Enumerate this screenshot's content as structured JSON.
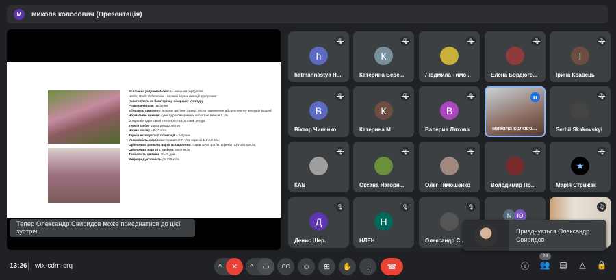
{
  "header": {
    "avatar_letter": "M",
    "title": "микола колосович (Презентація)"
  },
  "slide": {
    "lines": [
      {
        "b": "Echinacea purpurea Moench.- ",
        "t": "ехінацея пурпурова",
        "italic": true
      },
      {
        "b": "",
        "t": "Herba, Radix Echinaceae - трава і корені ехінації пурпурової",
        "italic": true
      },
      {
        "b": "Культивують як багаторічну лікарську культуру",
        "t": ""
      },
      {
        "b": "Розмножується: ",
        "t": "насінням"
      },
      {
        "b": "Збирають сировину: ",
        "t": "початок цвітіння (траву), після припинення або до початку вегетації (корені)"
      },
      {
        "b": "Нормативні вимоги: ",
        "t": "суми гідроксикоричних кислот не менше 2,1%"
      },
      {
        "b": "",
        "t": "В Україні є адаптовані технології та сортовий ресурс"
      },
      {
        "b": "Термін сівби",
        "t": " - друга декада квітня"
      },
      {
        "b": "Норма висіву",
        "t": " – 8-10 кг/га"
      },
      {
        "b": "Термін експлуатації плантації",
        "t": " – 3-4 роки"
      },
      {
        "b": "Урожайність сировини: ",
        "t": "трави 8,0-7, т/га; коренів 1,2-2,2 т/га;"
      },
      {
        "b": "Орієнтовна ринкова вартість сировини: ",
        "t": "трави 40-60 грн./кг; коренів -120-150 грн./кг;"
      },
      {
        "b": "Орієнтовна вартість насіння: ",
        "t": "500 грн./кг"
      },
      {
        "b": "Тривалість цвітіння ",
        "t": "30-40 днів."
      },
      {
        "b": "Медопродуктивність ",
        "t": "до 230 кг/га."
      }
    ]
  },
  "toast": "Тепер Олександр Свиридов може приєднатися до цієї зустрічі.",
  "participants": [
    {
      "name": "hatmannastya H...",
      "letter": "h",
      "color": "#5c6bc0"
    },
    {
      "name": "Катерина Бере...",
      "letter": "К",
      "color": "#78909c"
    },
    {
      "name": "Людмила Тимо...",
      "letter": "",
      "color": "#c9b03a"
    },
    {
      "name": "Елена Бордюго...",
      "letter": "",
      "color": "#8d3b3b"
    },
    {
      "name": "Ірина Кравець",
      "letter": "І",
      "color": "#6d4c41"
    },
    {
      "name": "Віктор Чипенко",
      "letter": "В",
      "color": "#5c6bc0"
    },
    {
      "name": "Катерина М",
      "letter": "К",
      "color": "#6d4c41"
    },
    {
      "name": "Валерия Ляхова",
      "letter": "В",
      "color": "#ab47bc"
    },
    {
      "name": "микола колосо...",
      "letter": "",
      "color": "",
      "active": true
    },
    {
      "name": "Serhii Skakovskyi",
      "letter": "",
      "color": "#444"
    },
    {
      "name": "КАВ",
      "letter": "",
      "color": "#9e9e9e"
    },
    {
      "name": "Оксана Нагорн...",
      "letter": "",
      "color": "#6b8f3a"
    },
    {
      "name": "Олег Тимошенко",
      "letter": "",
      "color": "#a1887f"
    },
    {
      "name": "Володимир По...",
      "letter": "",
      "color": "#7a2a2a"
    },
    {
      "name": "Марія Стрижак",
      "letter": "★",
      "color": "#000"
    },
    {
      "name": "Денис Шер.",
      "letter": "Д",
      "color": "#5e35b1"
    },
    {
      "name": "НЛЕН",
      "letter": "Н",
      "color": "#00695c"
    },
    {
      "name": "Олександр С...",
      "letter": "",
      "color": "#555"
    },
    {
      "name": "",
      "letter": "",
      "color": ""
    },
    {
      "name": "",
      "letter": "",
      "color": ""
    }
  ],
  "more_avatars": [
    "N",
    "Ю"
  ],
  "join_popup": {
    "text": "Приєднується Олександр Свиридов"
  },
  "bottom": {
    "time": "13:26",
    "meeting_code": "wtx-cdrn-crq",
    "participant_count": "28"
  },
  "colors": {
    "accent": "#8ab4f8",
    "danger": "#ea4335"
  }
}
